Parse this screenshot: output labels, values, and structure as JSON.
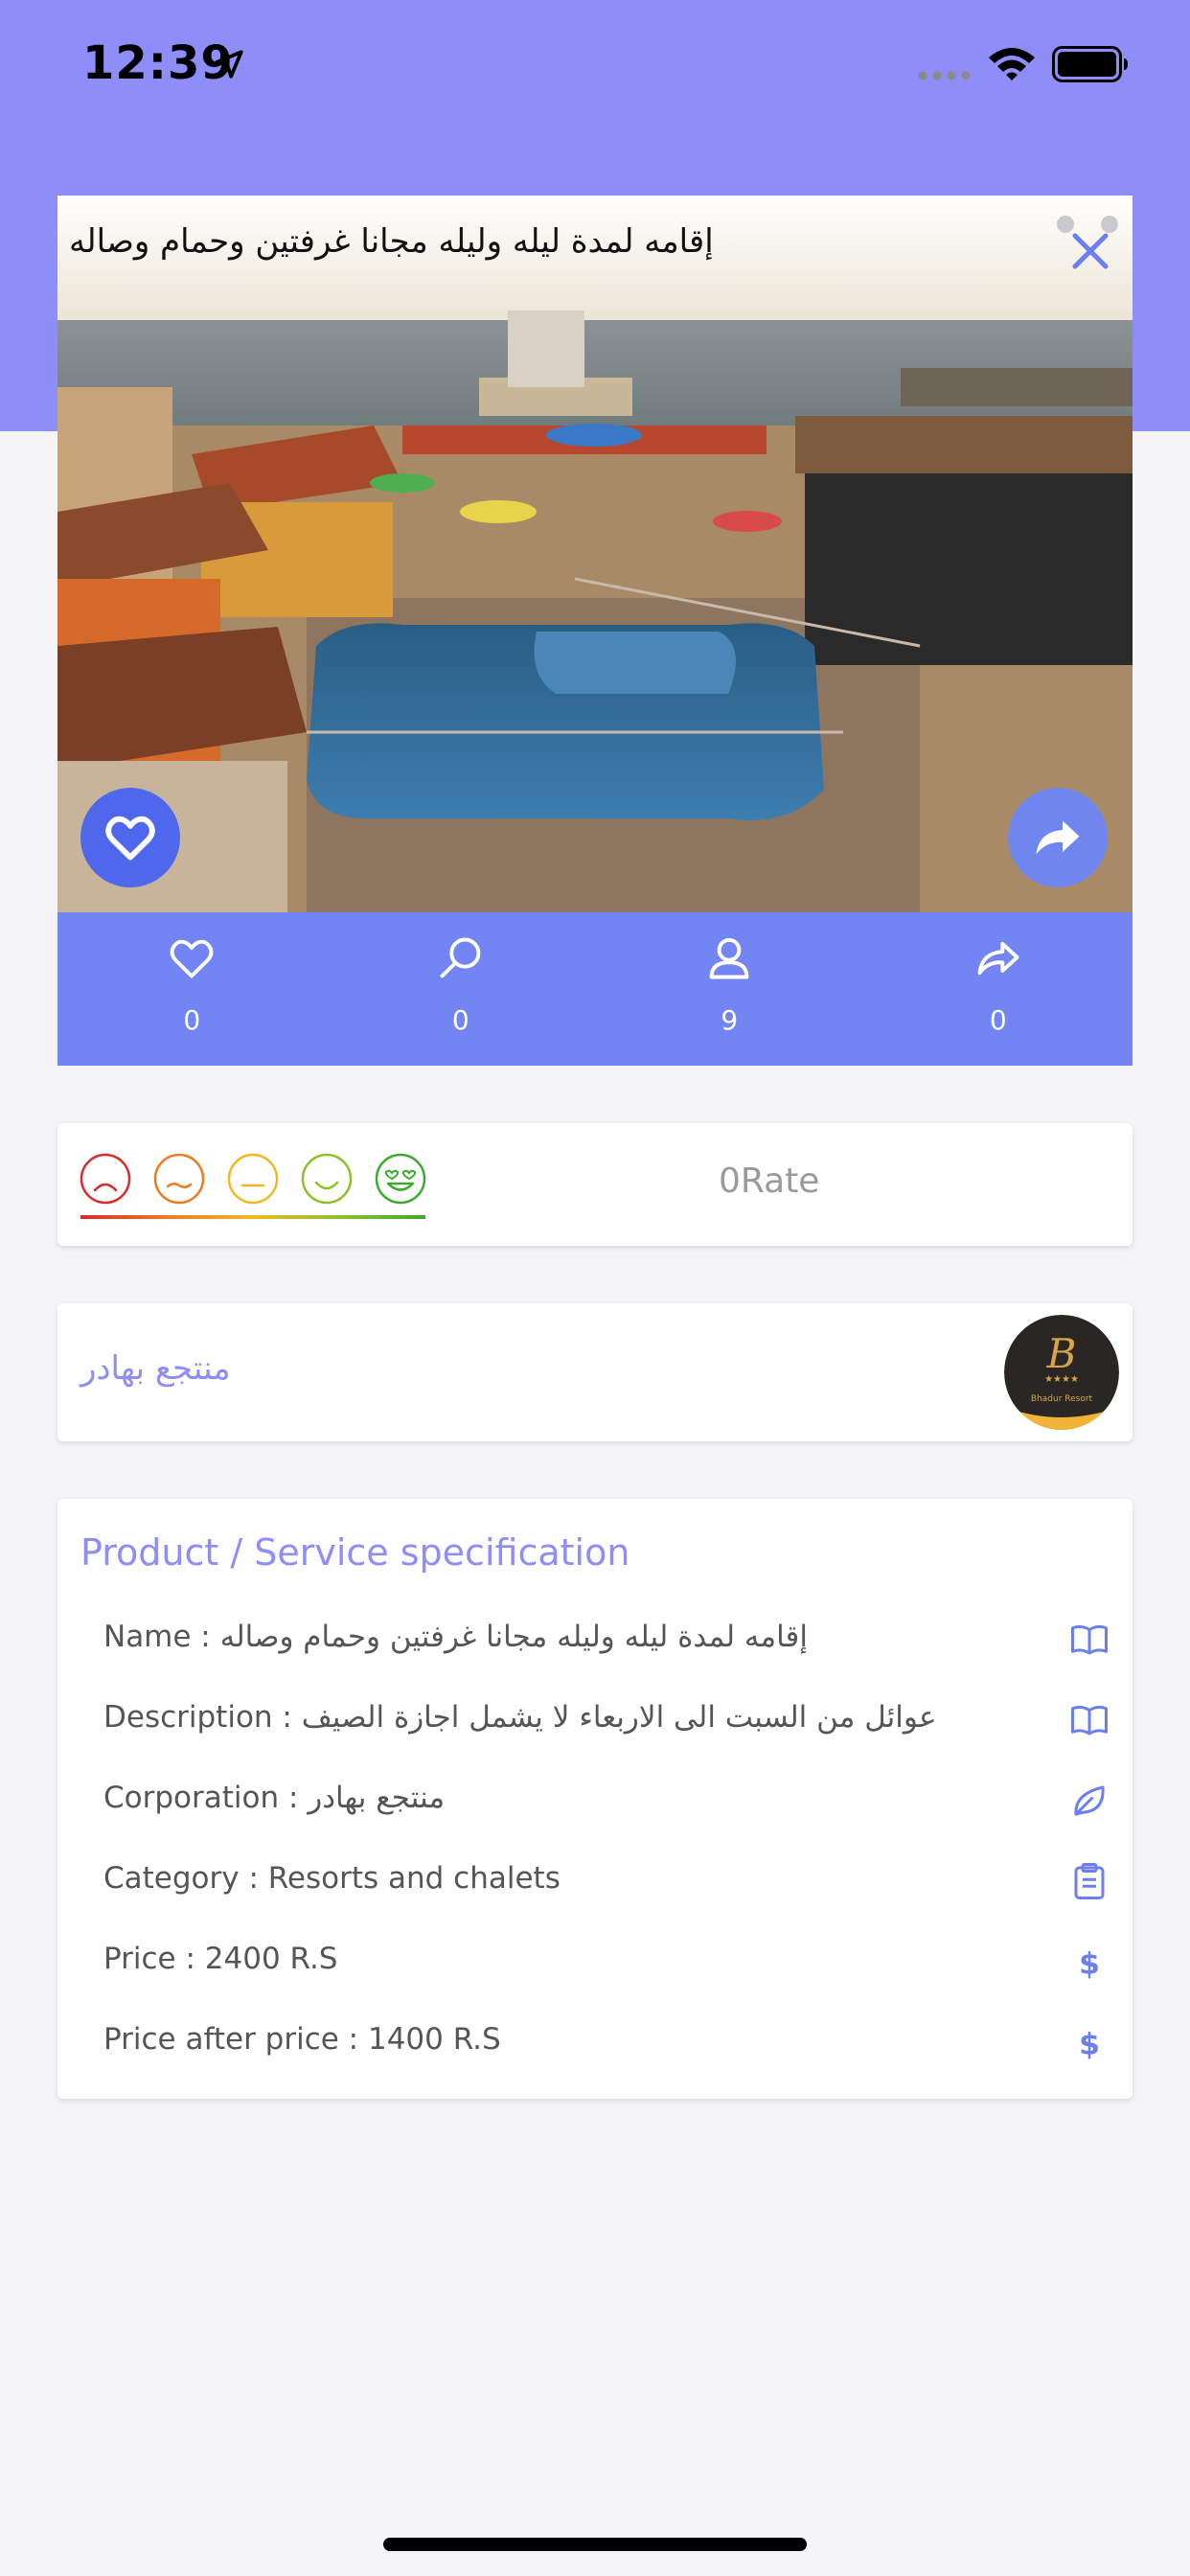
{
  "status_bar": {
    "time": "12:39"
  },
  "hero": {
    "title": "إقامه لمدة ليله وليله مجانا غرفتين وحمام وصاله"
  },
  "stats": [
    {
      "icon": "heart-outline-icon",
      "value": "0"
    },
    {
      "icon": "search-icon",
      "value": "0"
    },
    {
      "icon": "user-icon",
      "value": "9"
    },
    {
      "icon": "share-icon",
      "value": "0"
    }
  ],
  "rating": {
    "faces": [
      "very-sad-face-icon",
      "sad-face-icon",
      "neutral-face-icon",
      "smile-face-icon",
      "love-face-icon"
    ],
    "face_colors": [
      "#d92b2b",
      "#ee7a22",
      "#f1b823",
      "#8dc22a",
      "#3caa2f"
    ],
    "rate_text": "0Rate"
  },
  "corporation": {
    "name": "منتجع بهادر",
    "logo_text": "Bhadur Resort"
  },
  "spec": {
    "title": "Product / Service specification",
    "rows": [
      {
        "text": "Name : إقامه لمدة ليله وليله مجانا غرفتين وحمام وصاله",
        "icon": "book-icon"
      },
      {
        "text": "Description : عوائل من السبت الى الاربعاء لا يشمل اجازة الصيف",
        "icon": "book-icon"
      },
      {
        "text": "Corporation : منتجع بهادر",
        "icon": "leaf-icon"
      },
      {
        "text": "Category : Resorts and chalets",
        "icon": "clipboard-icon"
      },
      {
        "text": "Price : 2400  R.S",
        "icon": "dollar-icon"
      },
      {
        "text": "Price after price : 1400  R.S",
        "icon": "dollar-icon"
      }
    ]
  },
  "colors": {
    "accent": "#8f8df7",
    "stats_bar": "#7285f2",
    "fav_button": "#4f67ea"
  }
}
